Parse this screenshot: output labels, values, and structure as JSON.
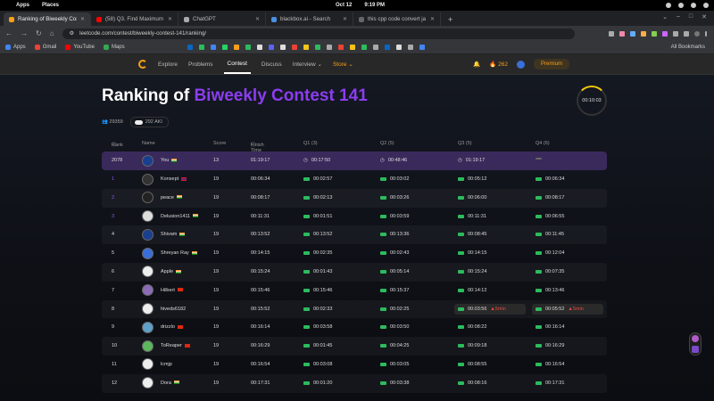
{
  "os": {
    "menu": [
      "Apps",
      "Places"
    ],
    "date": "Oct 12",
    "time": "9:19 PM"
  },
  "tabs": [
    {
      "title": "Ranking of Biweekly Cont",
      "active": true,
      "color": "#f89f1b"
    },
    {
      "title": "(58) Q3. Find Maximum R",
      "active": false,
      "color": "#ff0000"
    },
    {
      "title": "ChatGPT",
      "active": false,
      "color": "#aaaaaa"
    },
    {
      "title": "blackbox.ai - Search",
      "active": false,
      "color": "#4a90e2"
    },
    {
      "title": "this cpp code convert ja",
      "active": false,
      "color": "#666666"
    }
  ],
  "address": {
    "url": "leetcode.com/contest/biweekly-contest-141/ranking/"
  },
  "bookmarks": {
    "items": [
      "Apps",
      "Gmail",
      "YouTube",
      "Maps"
    ],
    "all": "All Bookmarks"
  },
  "nav": {
    "links": [
      "Explore",
      "Problems",
      "Contest",
      "Discuss",
      "Interview",
      "Store"
    ],
    "current": "Contest",
    "streak": "262",
    "premium": "Premium"
  },
  "page": {
    "title_prefix": "Ranking of ",
    "title_accent": "Biweekly Contest 141",
    "timer": "00:10:03",
    "participants": "29359",
    "aki": "292 AKI"
  },
  "table": {
    "headers": [
      "Rank",
      "Name",
      "Score",
      "Finish Time",
      "Q1 (3)",
      "Q2 (5)",
      "Q3 (5)",
      "Q4 (6)"
    ],
    "me": {
      "rank": "2078",
      "name": "You",
      "flag": "in",
      "score": "13",
      "finish": "01:19:17",
      "q1": "00:17:50",
      "q2": "00:48:46",
      "q3": "01:19:17",
      "q4": ""
    },
    "rows": [
      {
        "rank": "1",
        "name": "Konsept",
        "flag": "np",
        "score": "19",
        "finish": "00:06:34",
        "q1": "00:02:57",
        "q2": "00:03:02",
        "q3": "00:05:12",
        "q4": "00:06:34",
        "avatar": "#333333"
      },
      {
        "rank": "2",
        "name": "peace",
        "flag": "in",
        "score": "19",
        "finish": "00:08:17",
        "q1": "00:02:13",
        "q2": "00:03:26",
        "q3": "00:06:00",
        "q4": "00:08:17",
        "avatar": "#222222"
      },
      {
        "rank": "3",
        "name": "Delusion1411",
        "flag": "in",
        "score": "19",
        "finish": "00:11:31",
        "q1": "00:01:51",
        "q2": "00:03:59",
        "q3": "00:11:31",
        "q4": "00:06:55",
        "avatar": "#dddddd"
      },
      {
        "rank": "4",
        "name": "Shivam",
        "flag": "in",
        "score": "19",
        "finish": "00:13:52",
        "q1": "00:13:52",
        "q2": "00:13:36",
        "q3": "00:08:45",
        "q4": "00:11:45",
        "avatar": "#1a3f8f"
      },
      {
        "rank": "5",
        "name": "Shreyan Ray",
        "flag": "in",
        "score": "19",
        "finish": "00:14:15",
        "q1": "00:02:35",
        "q2": "00:02:43",
        "q3": "00:14:15",
        "q4": "00:12:04",
        "avatar": "#3b6fd8"
      },
      {
        "rank": "6",
        "name": "Apple",
        "flag": "in",
        "score": "19",
        "finish": "00:15:24",
        "q1": "00:01:43",
        "q2": "00:05:14",
        "q3": "00:15:24",
        "q4": "00:07:35",
        "avatar": "#eeeeee"
      },
      {
        "rank": "7",
        "name": "Hilbert",
        "flag": "cn",
        "score": "19",
        "finish": "00:15:46",
        "q1": "00:15:46",
        "q2": "00:15:37",
        "q3": "00:14:12",
        "q4": "00:13:46",
        "avatar": "#8a6db5"
      },
      {
        "rank": "8",
        "name": "hiveds6182",
        "flag": "",
        "score": "19",
        "finish": "00:15:52",
        "q1": "00:02:33",
        "q2": "00:02:25",
        "q3": "00:03:56",
        "q4": "00:05:52",
        "avatar": "#eeeeee",
        "q3_penalty": "5min",
        "q4_penalty": "5min"
      },
      {
        "rank": "9",
        "name": "drizzlo",
        "flag": "cn",
        "score": "19",
        "finish": "00:16:14",
        "q1": "00:03:58",
        "q2": "00:03:50",
        "q3": "00:08:22",
        "q4": "00:16:14",
        "avatar": "#5fa0c8"
      },
      {
        "rank": "10",
        "name": "ToReaper",
        "flag": "cn",
        "score": "19",
        "finish": "00:16:29",
        "q1": "00:01:45",
        "q2": "00:04:25",
        "q3": "00:09:18",
        "q4": "00:16:29",
        "avatar": "#5cb85c"
      },
      {
        "rank": "11",
        "name": "lcmjp",
        "flag": "",
        "score": "19",
        "finish": "00:16:54",
        "q1": "00:03:08",
        "q2": "00:03:05",
        "q3": "00:08:55",
        "q4": "00:16:54",
        "avatar": "#eeeeee"
      },
      {
        "rank": "12",
        "name": "Dora",
        "flag": "in",
        "score": "19",
        "finish": "00:17:31",
        "q1": "00:01:20",
        "q2": "00:03:38",
        "q3": "00:08:16",
        "q4": "00:17:31",
        "avatar": "#eeeeee"
      }
    ]
  },
  "colors": {
    "accent": "#8b3df0",
    "ok": "#2cbb5d",
    "brand": "#f89f1b",
    "penalty": "#ef4743"
  }
}
